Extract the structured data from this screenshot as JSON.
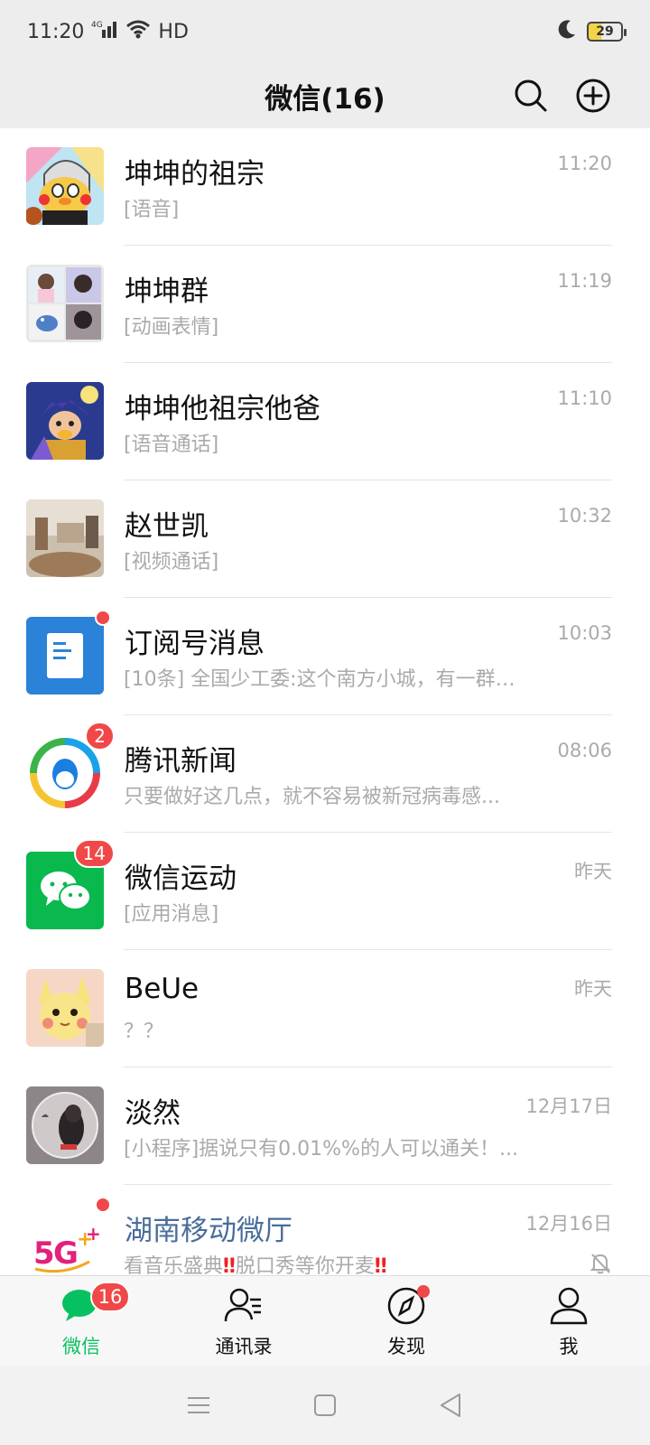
{
  "status": {
    "time": "11:20",
    "network": "4G",
    "hd": "HD",
    "battery": "29"
  },
  "header": {
    "title": "微信(16)"
  },
  "chats": [
    {
      "name": "坤坤的祖宗",
      "preview": "[语音]",
      "time": "11:20"
    },
    {
      "name": "坤坤群",
      "preview": "[动画表情]",
      "time": "11:19"
    },
    {
      "name": "坤坤他祖宗他爸",
      "preview": "[语音通话]",
      "time": "11:10"
    },
    {
      "name": "赵世凯",
      "preview": "[视频通话]",
      "time": "10:32"
    },
    {
      "name": "订阅号消息",
      "preview": "[10条] 全国少工委:这个南方小城，有一群“...",
      "time": "10:03"
    },
    {
      "name": "腾讯新闻",
      "preview": "只要做好这几点，就不容易被新冠病毒感...",
      "time": "08:06",
      "badge": "2"
    },
    {
      "name": "微信运动",
      "preview": "[应用消息]",
      "time": "昨天",
      "badge": "14"
    },
    {
      "name": "BeUe",
      "preview": "？？",
      "time": "昨天"
    },
    {
      "name": "淡然",
      "preview": "[小程序]据说只有0.01%%的人可以通关！...",
      "time": "12月17日"
    },
    {
      "name": "湖南移动微厅",
      "preview_a": "看音乐盛典",
      "preview_bang": "‼",
      "preview_b": "脱口秀等你开麦",
      "time": "12月16日"
    }
  ],
  "tabs": [
    {
      "label": "微信",
      "badge": "16"
    },
    {
      "label": "通讯录"
    },
    {
      "label": "发现"
    },
    {
      "label": "我"
    }
  ],
  "colors": {
    "accent": "#07c160",
    "badge": "#f04848",
    "background": "#ededed"
  }
}
